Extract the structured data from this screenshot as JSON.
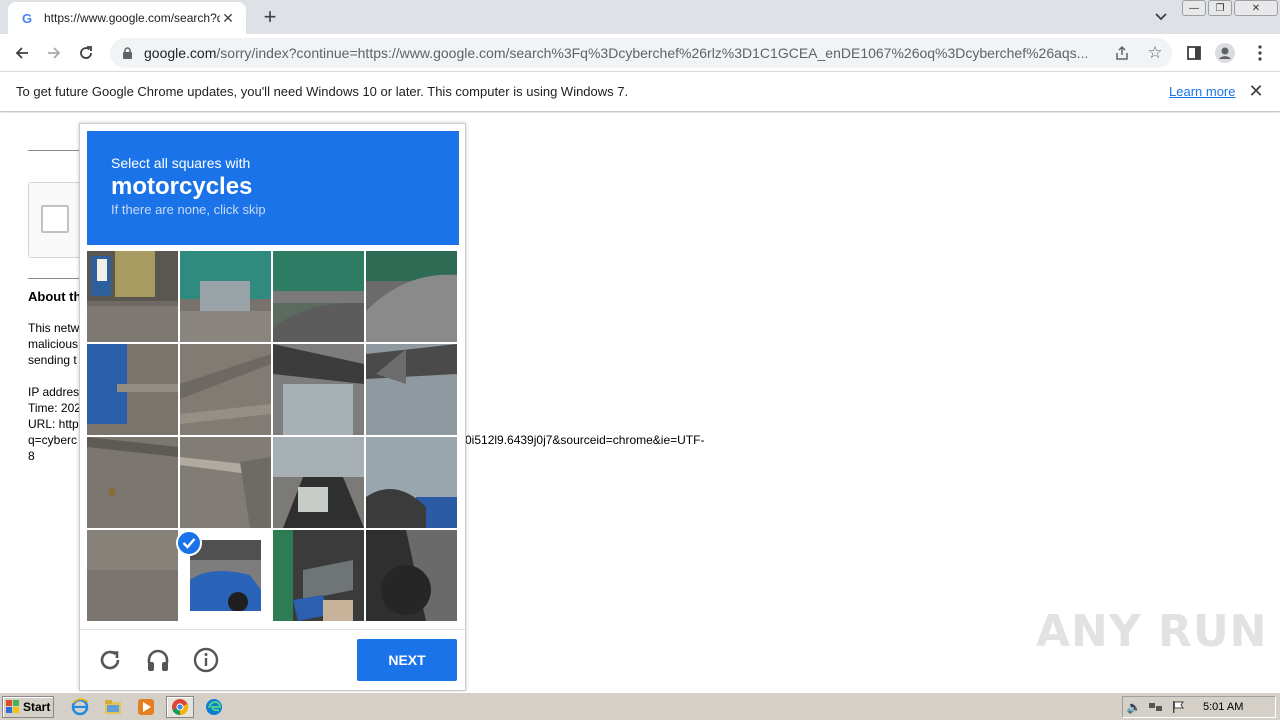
{
  "browser": {
    "tab_title": "https://www.google.com/search?q=",
    "url_domain": "google.com",
    "url_rest": "/sorry/index?continue=https://www.google.com/search%3Fq%3Dcyberchef%26rlz%3D1C1GCEA_enDE1067%26oq%3Dcyberchef%26aqs..."
  },
  "infobar": {
    "message": "To get future Google Chrome updates, you'll need Windows 10 or later. This computer is using Windows 7.",
    "link": "Learn more"
  },
  "page": {
    "about_heading": "About th",
    "para1": [
      "This netw",
      "malicious",
      "sending t"
    ],
    "para2": [
      "IP addres",
      "Time: 202",
      "URL: http",
      "q=cyberc",
      "8"
    ],
    "url_tail": "0i512l9.6439j0j7&sourceid=chrome&ie=UTF-"
  },
  "captcha": {
    "line1": "Select all squares with",
    "keyword": "motorcycles",
    "line3": "If there are none, click skip",
    "next_label": "NEXT",
    "selected_tiles": [
      13
    ]
  },
  "taskbar": {
    "start_label": "Start",
    "clock": "5:01 AM"
  },
  "watermark": "ANY RUN",
  "colors": {
    "accent": "#1a73e8",
    "taskbar": "#d4d0c8"
  }
}
